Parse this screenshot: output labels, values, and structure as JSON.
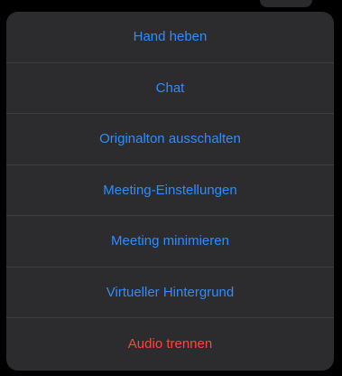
{
  "action_sheet": {
    "accent_color": "#2f8cff",
    "destructive_color": "#ff453a",
    "items": [
      {
        "label": "Hand heben"
      },
      {
        "label": "Chat"
      },
      {
        "label": "Originalton ausschalten"
      },
      {
        "label": "Meeting-Einstellungen"
      },
      {
        "label": "Meeting minimieren"
      },
      {
        "label": "Virtueller Hintergrund"
      },
      {
        "label": "Audio trennen"
      }
    ]
  }
}
